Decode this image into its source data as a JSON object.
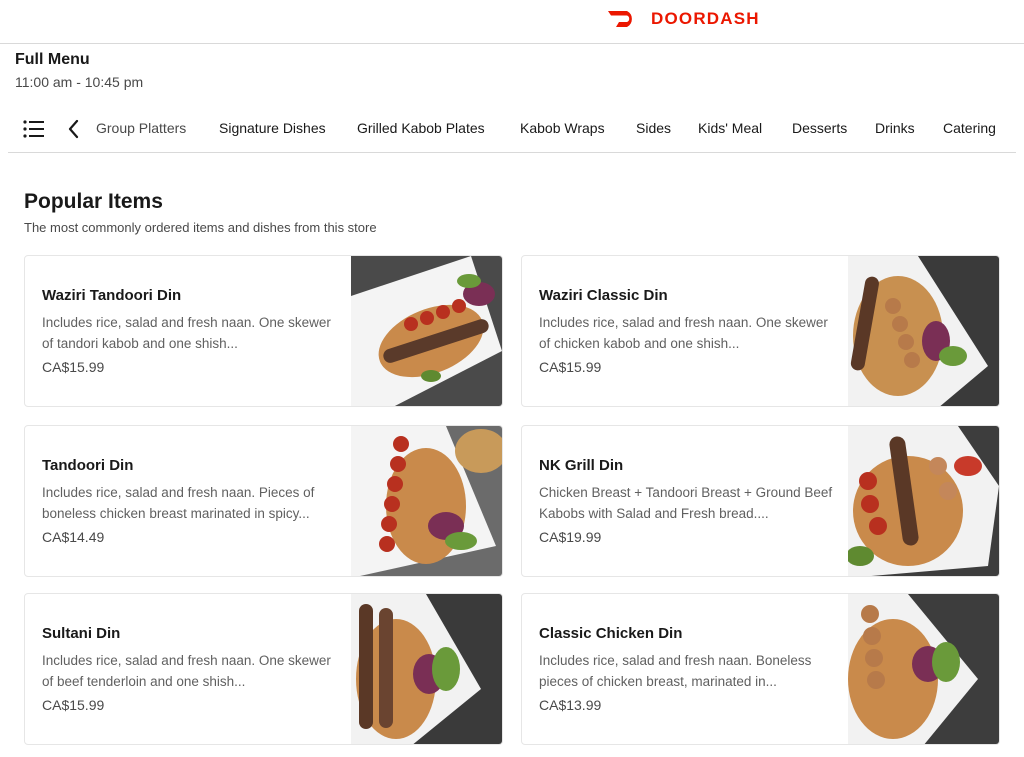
{
  "brand": {
    "name": "DOORDASH",
    "color": "#eb1700"
  },
  "menu": {
    "title": "Full Menu",
    "hours": "11:00 am - 10:45 pm"
  },
  "category_nav": {
    "list_icon": "list-icon",
    "back_icon": "chevron-left-icon",
    "items": [
      "Group Platters",
      "Signature Dishes",
      "Grilled Kabob Plates",
      "Kabob Wraps",
      "Sides",
      "Kids' Meal",
      "Desserts",
      "Drinks",
      "Catering"
    ]
  },
  "popular": {
    "title": "Popular Items",
    "subtitle": "The most commonly ordered items and dishes from this store",
    "items": [
      {
        "name": "Waziri Tandoori Din",
        "description": "Includes rice, salad and fresh naan. One skewer of tandori kabob and one shish...",
        "price": "CA$15.99"
      },
      {
        "name": "Waziri Classic Din",
        "description": "Includes rice, salad and fresh naan. One skewer of chicken kabob and one shish...",
        "price": "CA$15.99"
      },
      {
        "name": "Tandoori Din",
        "description": "Includes rice, salad and fresh naan. Pieces of boneless chicken breast marinated in spicy...",
        "price": "CA$14.49"
      },
      {
        "name": "NK Grill Din",
        "description": "Chicken Breast + Tandoori Breast + Ground Beef Kabobs with Salad and Fresh bread....",
        "price": "CA$19.99"
      },
      {
        "name": "Sultani Din",
        "description": "Includes rice, salad and fresh naan. One skewer of beef tenderloin and one shish...",
        "price": "CA$15.99"
      },
      {
        "name": "Classic Chicken Din",
        "description": "Includes rice, salad and fresh naan. Boneless pieces of chicken breast, marinated in...",
        "price": "CA$13.99"
      }
    ]
  }
}
